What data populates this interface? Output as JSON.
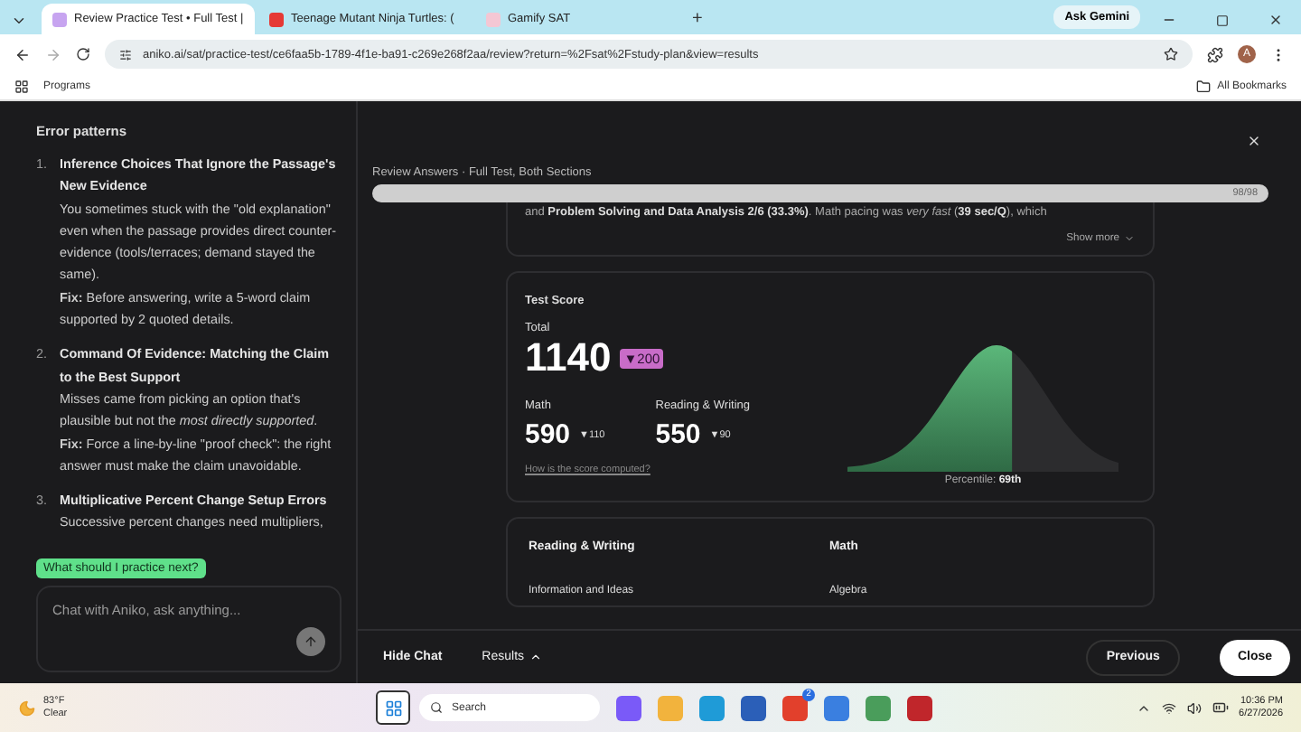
{
  "browser": {
    "tabs": [
      {
        "title": "Review Practice Test • Full Test |",
        "kind": "aniko",
        "selected": true
      },
      {
        "title": "Teenage Mutant Ninja Turtles: (",
        "kind": "video",
        "selected": false
      },
      {
        "title": "Gamify SAT",
        "kind": "gamify",
        "selected": false
      }
    ],
    "new_tab": "+",
    "ask_gemini": "Ask Gemini",
    "url": "aniko.ai/sat/practice-test/ce6faa5b-1789-4f1e-ba91-c269e268f2aa/review?return=%2Fsat%2Fstudy-plan&view=results",
    "avatar": "A",
    "bookmarks": [
      "Programs"
    ],
    "all_bookmarks": "All Bookmarks"
  },
  "chat": {
    "heading": "Error patterns",
    "items": [
      {
        "number": "1.",
        "title": "Inference Choices That Ignore the Passage's New Evidence",
        "body": "You sometimes stuck with the \"old explanation\" even when the passage provides direct counter-evidence (tools/terraces; demand stayed the same).",
        "fix": "**Fix:** Before answering, write a 5-word claim supported by 2 quoted details."
      },
      {
        "number": "2.",
        "title": "Command Of Evidence: Matching the Claim to the Best Support",
        "body": "Misses came from picking an option that's plausible but not the *most directly supported*.",
        "fix": "**Fix:** Force a line-by-line \"proof check\": the right answer must make the claim unavoidable."
      },
      {
        "number": "3.",
        "title": "Multiplicative Percent Change Setup Errors",
        "body": "Successive percent changes need multipliers,"
      }
    ],
    "suggestion": "What should I practice next?",
    "placeholder": "Chat with Aniko, ask anything..."
  },
  "review": {
    "title": "Review Answers · Full Test, Both Sections",
    "progress": {
      "level": 1,
      "reading": "98/98"
    },
    "summary": "and **Problem Solving and Data Analysis 2/6 (33.3%)**. Math pacing was *very fast* (**39 sec/Q**), which",
    "show_more": "Show more",
    "score": {
      "title": "Test Score",
      "total_label": "Total",
      "total": "1140",
      "total_delta": "▼200",
      "sections": [
        {
          "label": "Math",
          "score": "590",
          "delta": "▼110"
        },
        {
          "label": "Reading & Writing",
          "score": "550",
          "delta": "▼90"
        }
      ],
      "link": "How is the score computed?",
      "percentile_label": "Percentile:",
      "percentile": "69th"
    },
    "breakdown": {
      "columns": [
        {
          "heading": "Reading & Writing",
          "first_row": "Information and Ideas"
        },
        {
          "heading": "Math",
          "first_row": "Algebra"
        }
      ]
    }
  },
  "footer": {
    "hide_chat": "Hide Chat",
    "results": "Results",
    "previous": "Previous",
    "close": "Close"
  },
  "taskbar": {
    "temperature": "83°F",
    "condition": "Clear",
    "search": "Search",
    "badge": "2",
    "time": "10:36 PM",
    "date": "6/27/2026"
  }
}
